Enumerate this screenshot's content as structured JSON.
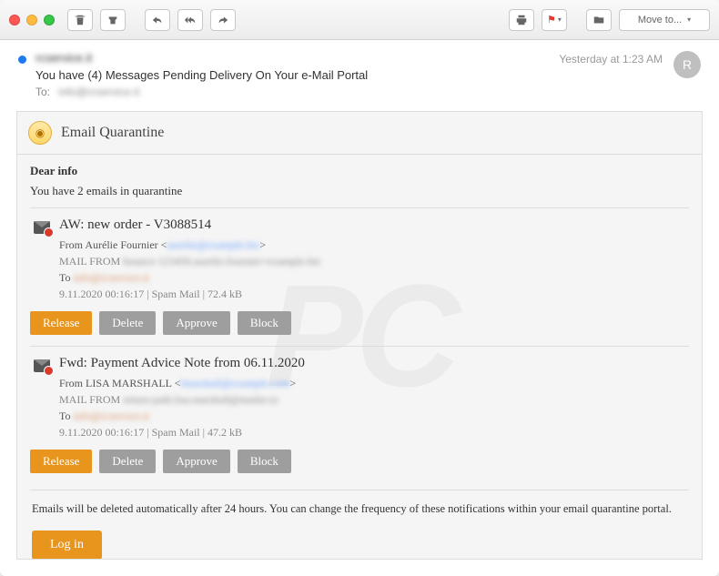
{
  "toolbar": {
    "move_to_label": "Move to..."
  },
  "header": {
    "sender": "rcservice.it",
    "subject": "You have (4) Messages Pending Delivery On Your e-Mail Portal",
    "to_label": "To:",
    "to_value": "info@rcservice.it",
    "timestamp": "Yesterday at 1:23 AM",
    "avatar_initial": "R"
  },
  "quarantine": {
    "title": "Email Quarantine",
    "greeting": "Dear info",
    "intro": "You have 2 emails in quarantine",
    "items": [
      {
        "subject": "AW: new order - V3088514",
        "from_label": "From  Aurélie Fournier <",
        "from_email_blur": "aurelie@example.biz",
        "from_close": ">",
        "mailfrom_label": "MAIL FROM ",
        "mailfrom_blur": "bounce-123456.aurelie.fournier=example.biz",
        "to_label": "To ",
        "to_blur": "info@rcservice.it",
        "stats": "9.11.2020 00:16:17 | Spam Mail | 72.4 kB"
      },
      {
        "subject": "Fwd: Payment Advice Note from 06.11.2020",
        "from_label": "From LISA MARSHALL <",
        "from_email_blur": "lmarshall@example.com",
        "from_close": ">",
        "mailfrom_label": "MAIL FROM ",
        "mailfrom_blur": "return-path.lisa.marshall@mailer.io",
        "to_label": "To ",
        "to_blur": "info@rcservice.it",
        "stats": "9.11.2020 00:16:17 | Spam Mail | 47.2 kB"
      }
    ],
    "buttons": {
      "release": "Release",
      "delete": "Delete",
      "approve": "Approve",
      "block": "Block"
    },
    "footer_text": "Emails will be deleted automatically after 24 hours. You can change the frequency of these notifications within your email quarantine portal.",
    "login_label": "Log in"
  }
}
